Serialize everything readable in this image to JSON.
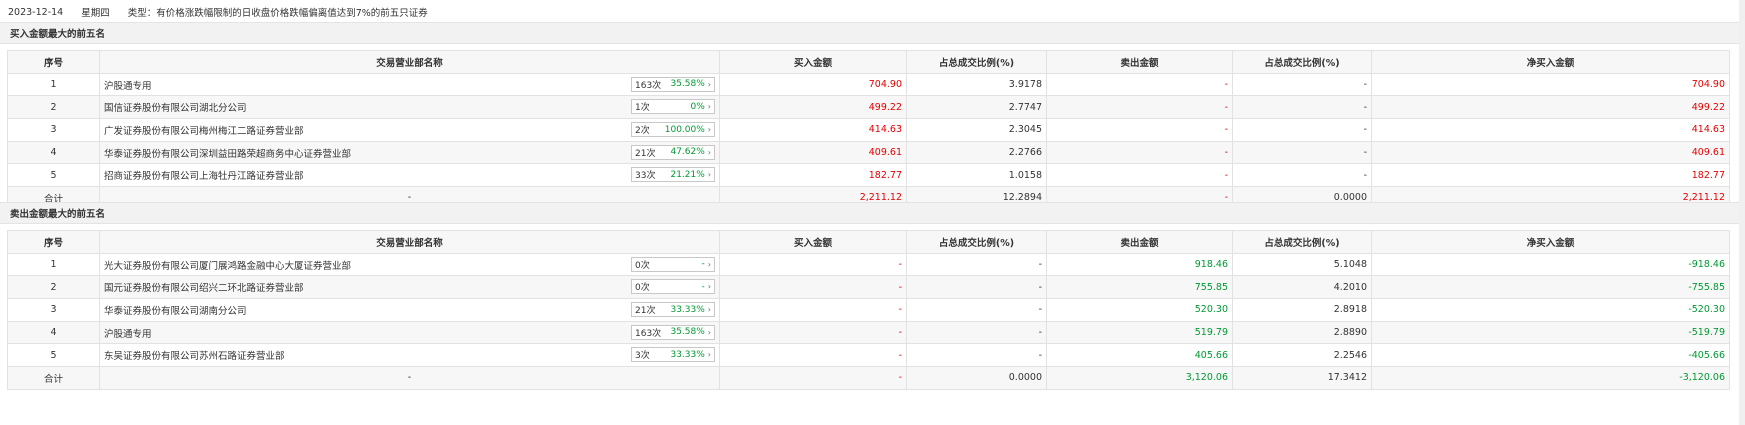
{
  "header": {
    "date": "2023-12-14",
    "weekday": "星期四",
    "type_text": "类型：有价格涨跌幅限制的日收盘价格跌幅偏离值达到7%的前五只证券"
  },
  "columns": [
    "序号",
    "交易营业部名称",
    "买入金额",
    "占总成交比例(%)",
    "卖出金额",
    "占总成交比例(%)",
    "净买入金额"
  ],
  "buy_section": {
    "title": "买入金额最大的前五名",
    "rows": [
      {
        "idx": "1",
        "name": "沪股通专用",
        "count": "163次",
        "pct": "35.58%",
        "buy": "704.90",
        "buy_ratio": "3.9178",
        "sell": "-",
        "sell_ratio": "-",
        "net": "704.90"
      },
      {
        "idx": "2",
        "name": "国信证券股份有限公司湖北分公司",
        "count": "1次",
        "pct": "0%",
        "buy": "499.22",
        "buy_ratio": "2.7747",
        "sell": "-",
        "sell_ratio": "-",
        "net": "499.22"
      },
      {
        "idx": "3",
        "name": "广发证券股份有限公司梅州梅江二路证券营业部",
        "count": "2次",
        "pct": "100.00%",
        "buy": "414.63",
        "buy_ratio": "2.3045",
        "sell": "-",
        "sell_ratio": "-",
        "net": "414.63"
      },
      {
        "idx": "4",
        "name": "华泰证券股份有限公司深圳益田路荣超商务中心证券营业部",
        "count": "21次",
        "pct": "47.62%",
        "buy": "409.61",
        "buy_ratio": "2.2766",
        "sell": "-",
        "sell_ratio": "-",
        "net": "409.61"
      },
      {
        "idx": "5",
        "name": "招商证券股份有限公司上海牡丹江路证券营业部",
        "count": "33次",
        "pct": "21.21%",
        "buy": "182.77",
        "buy_ratio": "1.0158",
        "sell": "-",
        "sell_ratio": "-",
        "net": "182.77"
      }
    ],
    "total": {
      "label": "合计",
      "name": "-",
      "buy": "2,211.12",
      "buy_ratio": "12.2894",
      "sell": "-",
      "sell_ratio": "0.0000",
      "net": "2,211.12"
    }
  },
  "sell_section": {
    "title": "卖出金额最大的前五名",
    "rows": [
      {
        "idx": "1",
        "name": "光大证券股份有限公司厦门展鸿路金融中心大厦证券营业部",
        "count": "0次",
        "pct": "-",
        "buy": "-",
        "buy_ratio": "-",
        "sell": "918.46",
        "sell_ratio": "5.1048",
        "net": "-918.46"
      },
      {
        "idx": "2",
        "name": "国元证券股份有限公司绍兴二环北路证券营业部",
        "count": "0次",
        "pct": "-",
        "buy": "-",
        "buy_ratio": "-",
        "sell": "755.85",
        "sell_ratio": "4.2010",
        "net": "-755.85"
      },
      {
        "idx": "3",
        "name": "华泰证券股份有限公司湖南分公司",
        "count": "21次",
        "pct": "33.33%",
        "buy": "-",
        "buy_ratio": "-",
        "sell": "520.30",
        "sell_ratio": "2.8918",
        "net": "-520.30"
      },
      {
        "idx": "4",
        "name": "沪股通专用",
        "count": "163次",
        "pct": "35.58%",
        "buy": "-",
        "buy_ratio": "-",
        "sell": "519.79",
        "sell_ratio": "2.8890",
        "net": "-519.79"
      },
      {
        "idx": "5",
        "name": "东吴证券股份有限公司苏州石路证券营业部",
        "count": "3次",
        "pct": "33.33%",
        "buy": "-",
        "buy_ratio": "-",
        "sell": "405.66",
        "sell_ratio": "2.2546",
        "net": "-405.66"
      }
    ],
    "total": {
      "label": "合计",
      "name": "-",
      "buy": "-",
      "buy_ratio": "0.0000",
      "sell": "3,120.06",
      "sell_ratio": "17.3412",
      "net": "-3,120.06"
    }
  },
  "colors": {
    "positive": "#e60000",
    "negative": "#009933",
    "header_bg": "#f2f2f2",
    "border": "#e2e2e2"
  },
  "icons": {
    "badge_arrow": "chevron-right-icon"
  }
}
